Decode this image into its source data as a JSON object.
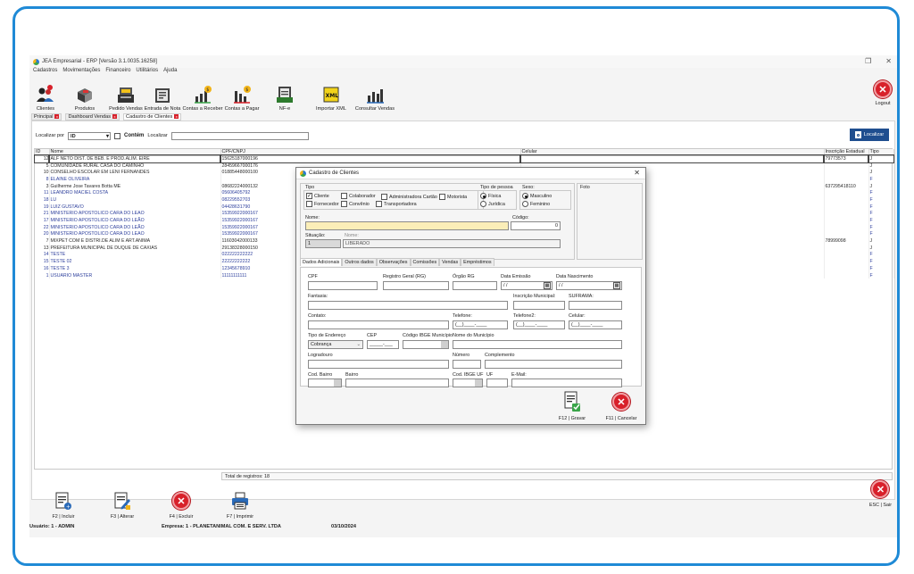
{
  "app": {
    "title": "JEA Empresarial - ERP [Versão 3.1.0035.16258]",
    "menu": [
      "Cadastros",
      "Movimentações",
      "Financeiro",
      "Utilitários",
      "Ajuda"
    ],
    "toolbar": [
      "Clientes",
      "Produtos",
      "Pedido Vendas",
      "Entrada de Nota",
      "Contas a Receber",
      "Contas a Pagar",
      "NF-e",
      "Importar XML",
      "Consultar Vendas"
    ],
    "logout": "Logout",
    "tabs": [
      "Principal",
      "Dashboard Vendas",
      "Cadastro de Clientes"
    ]
  },
  "search": {
    "label": "Localizar por",
    "field": "ID",
    "contem": "Contém",
    "localizar_label": "Localizar",
    "button": "Localizar"
  },
  "grid": {
    "headers": [
      "ID",
      "Nome",
      "CPF/CNPJ",
      "Celular",
      "Inscrição Estadual",
      "Tipo"
    ],
    "rows": [
      {
        "id": "12",
        "nome": "ALF NETO DIST. DE BEB. E PROD.ALIM. EIRE",
        "cpf": "15625187000196",
        "cel": "",
        "ie": "79773573",
        "tipo": "J"
      },
      {
        "id": "5",
        "nome": "COMUNIDADE RURAL CASA DO CAMINHO",
        "cpf": "28459667000176",
        "cel": "",
        "ie": "",
        "tipo": "J"
      },
      {
        "id": "10",
        "nome": "CONSELHO ESCOLAR EM LENI FERNANDES",
        "cpf": "01885448000100",
        "cel": "",
        "ie": "",
        "tipo": "J"
      },
      {
        "id": "8",
        "nome": "ELAINE OLIVEIRA",
        "cpf": "",
        "cel": "",
        "ie": "",
        "tipo": "F"
      },
      {
        "id": "3",
        "nome": "Guilherme Jose Tavares Botta ME",
        "cpf": "08682224000132",
        "cel": "",
        "ie": "637295418110",
        "tipo": "J"
      },
      {
        "id": "11",
        "nome": "LEANDRO MACIEL COSTA",
        "cpf": "05606405792",
        "cel": "",
        "ie": "",
        "tipo": "F"
      },
      {
        "id": "18",
        "nome": "LU",
        "cpf": "08229552703",
        "cel": "",
        "ie": "",
        "tipo": "F"
      },
      {
        "id": "19",
        "nome": "LUIZ GUSTAVO",
        "cpf": "04428631790",
        "cel": "",
        "ie": "",
        "tipo": "F"
      },
      {
        "id": "21",
        "nome": "MINISTERIO APOSTOLICO CARA DO LEAO",
        "cpf": "15359922000167",
        "cel": "",
        "ie": "",
        "tipo": "F"
      },
      {
        "id": "17",
        "nome": "MINISTERIO APOSTOLICO CARA DO LEÃO",
        "cpf": "15359922000167",
        "cel": "",
        "ie": "",
        "tipo": "F"
      },
      {
        "id": "22",
        "nome": "MINISTERIO APOSTOLICO CARA DO LEÃO",
        "cpf": "15359922000167",
        "cel": "",
        "ie": "",
        "tipo": "F"
      },
      {
        "id": "20",
        "nome": "MINISTERIO APOSTOLICO CARA DO LEÃO",
        "cpf": "15359922000167",
        "cel": "",
        "ie": "",
        "tipo": "F"
      },
      {
        "id": "7",
        "nome": "MIXPET COM E DISTRI.DE ALIM E ART.ANIMA",
        "cpf": "11603042000133",
        "cel": "",
        "ie": "78999098",
        "tipo": "J"
      },
      {
        "id": "13",
        "nome": "PREFEITURA MUNICIPAL DE DUQUE DE CAXIAS",
        "cpf": "29138328000150",
        "cel": "",
        "ie": "",
        "tipo": "J"
      },
      {
        "id": "14",
        "nome": "TESTE",
        "cpf": "022222222222",
        "cel": "",
        "ie": "",
        "tipo": "F"
      },
      {
        "id": "15",
        "nome": "TESTE 02",
        "cpf": "22222222222",
        "cel": "",
        "ie": "",
        "tipo": "F"
      },
      {
        "id": "16",
        "nome": "TESTE 3",
        "cpf": "12345678910",
        "cel": "",
        "ie": "",
        "tipo": "F"
      },
      {
        "id": "1",
        "nome": "USUARIO MASTER",
        "cpf": "11111111111",
        "cel": "",
        "ie": "",
        "tipo": "F"
      }
    ],
    "total": "Total de registros: 18"
  },
  "bottom": {
    "buttons": [
      "F2 | Incluir",
      "F3 | Alterar",
      "F4 | Excluir",
      "F7 | Imprimir"
    ],
    "esc": "ESC | Sair"
  },
  "status": {
    "usuario": "Usuário: 1 - ADMIN",
    "empresa": "Empresa: 1 - PLANETANIMAL COM. E SERV. LTDA",
    "data": "03/10/2024"
  },
  "dialog": {
    "title": "Cadastro de Clientes",
    "tipo_label": "Tipo",
    "tipos": [
      {
        "label": "Cliente",
        "checked": true
      },
      {
        "label": "Colaborador",
        "checked": false
      },
      {
        "label": "Administradora Cartão",
        "checked": false
      },
      {
        "label": "Motorista",
        "checked": false
      },
      {
        "label": "Fornecedor",
        "checked": false
      },
      {
        "label": "Convênio",
        "checked": false
      },
      {
        "label": "Transportadora",
        "checked": false
      }
    ],
    "tipo_pessoa_label": "Tipo de pessoa",
    "pessoa": [
      "Física",
      "Jurídica"
    ],
    "sexo_label": "Sexo:",
    "sexo": [
      "Masculino",
      "Feminino"
    ],
    "foto_label": "Foto",
    "nome_label": "Nome:",
    "codigo_label": "Código:",
    "codigo_value": "0",
    "situacao_label": "Situação:",
    "situacao_code": "1",
    "situacao_nome_label": "Nome:",
    "situacao_nome": "LIBERADO",
    "tabs": [
      "Dados Adicionais",
      "Outros dados",
      "Observações",
      "Comissões",
      "Vendas",
      "Empréstimos"
    ],
    "fields": {
      "cpf": "CPF",
      "rg": "Registro Geral (RG)",
      "orgao": "Órgão RG",
      "emissao": "Data Emissão",
      "nascimento": "Data Nascimento",
      "date_placeholder": "/ /",
      "fantasia": "Fantasia:",
      "inscricao": "Inscrição Municipal:",
      "suframa": "SUFRAMA:",
      "contato": "Contato:",
      "telefone": "Telefone:",
      "telefone2": "Telefone2:",
      "celular": "Celular:",
      "phone_mask": "(__)____-____",
      "tipo_endereco": "Tipo de Endereço",
      "tipo_endereco_value": "Cobrança",
      "cep": "CEP",
      "cep_mask": "_____-___",
      "ibge_mun": "Código IBGE Município",
      "nome_mun": "Nome do Município",
      "logradouro": "Logradouro",
      "numero": "Número",
      "complemento": "Complemento",
      "cod_bairro": "Cod. Bairro",
      "bairro": "Bairro",
      "ibge_uf": "Cod. IBGE UF",
      "uf": "UF",
      "email": "E-Mail:"
    },
    "gravar": "F12 | Gravar",
    "cancelar": "F11 | Cancelar"
  }
}
